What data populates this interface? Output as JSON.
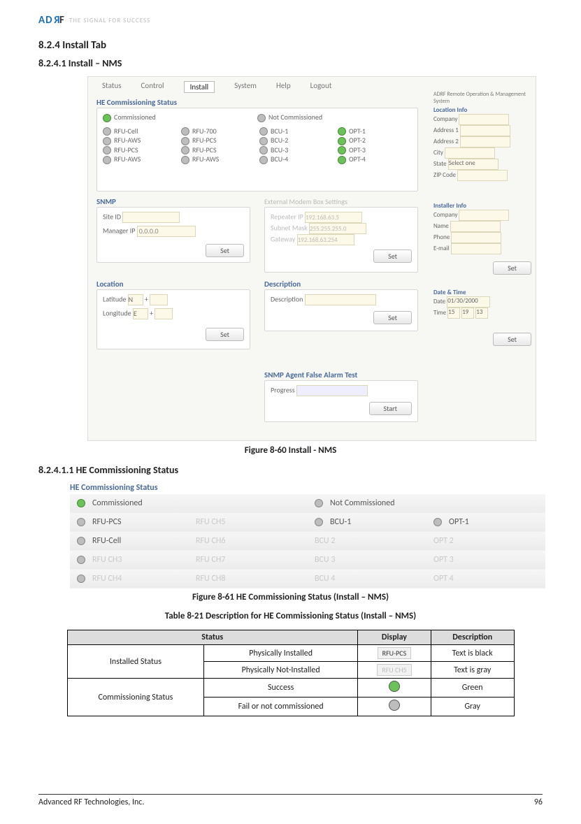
{
  "header": {
    "logo_tagline": "THE SIGNAL FOR SUCCESS"
  },
  "sections": {
    "s824": "8.2.4     Install Tab",
    "s8241": "8.2.4.1    Install – NMS",
    "s82411": "8.2.4.1.1        HE Commissioning Status"
  },
  "fig60": {
    "tabs": [
      "Status",
      "Control",
      "Install",
      "System",
      "Help",
      "Logout"
    ],
    "active_tab": "Install",
    "he_label": "HE Commissioning Status",
    "commissioned": "Commissioned",
    "not_commissioned": "Not Commissioned",
    "grid_col1": [
      "RFU-Cell",
      "RFU-AWS",
      "RFU-PCS",
      "RFU-AWS"
    ],
    "grid_col2": [
      "RFU-700",
      "RFU-PCS",
      "RFU-PCS",
      "RFU-AWS"
    ],
    "grid_col3": [
      "BCU-1",
      "BCU-2",
      "BCU-3",
      "BCU-4"
    ],
    "grid_col4": [
      "OPT-1",
      "OPT-2",
      "OPT-3",
      "OPT-4"
    ],
    "snmp_label": "SNMP",
    "snmp_siteid": "Site ID",
    "snmp_mgrip": "Manager IP",
    "snmp_mgrip_val": "0.0.0.0",
    "set": "Set",
    "ext_modem": "External Modem Box Settings",
    "rep_ip": "Repeater IP",
    "rep_ip_val": "192.168.63.5",
    "sub_mask": "Subnet Mask",
    "sub_mask_val": "255.255.255.0",
    "gateway": "Gateway",
    "gateway_val": "192.168.63.254",
    "location_label": "Location",
    "lat": "Latitude",
    "lat_dir": "N",
    "lon": "Longitude",
    "lon_dir": "E",
    "description_label": "Description",
    "desc_field": "Description",
    "false_alarm": "SNMP Agent False Alarm Test",
    "progress": "Progress",
    "start": "Start",
    "right_title": "ADRF Remote Operation & Management System",
    "loc_info": "Location Info",
    "loc_fields": [
      "Company",
      "Address 1",
      "Address 2",
      "City",
      "State",
      "ZIP Code"
    ],
    "state_val": "Select one",
    "inst_info": "Installer Info",
    "inst_fields": [
      "Company",
      "Name",
      "Phone",
      "E-mail"
    ],
    "date_time": "Date & Time",
    "date_lbl": "Date",
    "date_val": "01/30/2000",
    "time_lbl": "Time",
    "time_h": "15",
    "time_m": "19",
    "time_s": "13"
  },
  "captions": {
    "fig60": "Figure 8-60   Install - NMS",
    "fig61": "Figure 8-61   HE Commissioning Status (Install – NMS)",
    "tbl21": "Table 8-21    Description for HE Commissioning Status (Install – NMS)"
  },
  "fig61": {
    "title": "HE Commissioning Status",
    "commissioned": "Commissioned",
    "not_commissioned": "Not Commissioned",
    "rows": [
      {
        "c1": "RFU-PCS",
        "c1dim": false,
        "c2": "RFU CH5",
        "c2dim": true,
        "c3": "BCU-1",
        "c3dim": false,
        "c3dot": true,
        "c4": "OPT-1",
        "c4dim": false,
        "c4dot": true
      },
      {
        "c1": "RFU-Cell",
        "c1dim": false,
        "c2": "RFU CH6",
        "c2dim": true,
        "c3": "BCU 2",
        "c3dim": true,
        "c3dot": false,
        "c4": "OPT 2",
        "c4dim": true,
        "c4dot": false
      },
      {
        "c1": "RFU CH3",
        "c1dim": true,
        "c2": "RFU CH7",
        "c2dim": true,
        "c3": "BCU 3",
        "c3dim": true,
        "c3dot": false,
        "c4": "OPT 3",
        "c4dim": true,
        "c4dot": false
      },
      {
        "c1": "RFU CH4",
        "c1dim": true,
        "c2": "RFU CH8",
        "c2dim": true,
        "c3": "BCU 4",
        "c3dim": true,
        "c3dot": false,
        "c4": "OPT 4",
        "c4dim": true,
        "c4dot": false
      }
    ]
  },
  "table821": {
    "headers": [
      "Status",
      "Display",
      "Description"
    ],
    "installed_status": "Installed Status",
    "commissioning_status": "Commissioning Status",
    "r1": {
      "sub": "Physically Installed",
      "disp": "RFU-PCS",
      "desc": "Text is black"
    },
    "r2": {
      "sub": "Physically Not-Installed",
      "disp": "RFU CH5",
      "desc": "Text is gray"
    },
    "r3": {
      "sub": "Success",
      "desc": "Green"
    },
    "r4": {
      "sub": "Fail or not commissioned",
      "desc": "Gray"
    }
  },
  "footer": {
    "company": "Advanced RF Technologies, Inc.",
    "page": "96"
  }
}
